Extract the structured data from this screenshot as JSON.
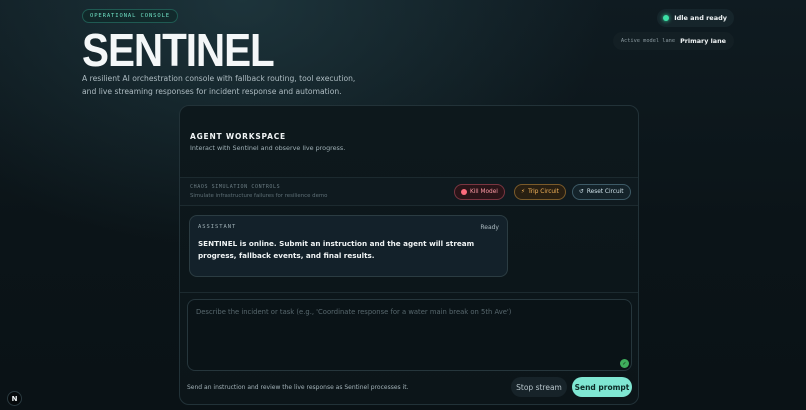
{
  "header": {
    "badge": "OPERATIONAL CONSOLE",
    "title": "SENTINEL",
    "subtitle": "A resilient AI orchestration console with fallback routing, tool execution, and live streaming responses for incident response and automation."
  },
  "status": {
    "text": "Idle and ready",
    "lane_label": "Active model lane",
    "lane_value": "Primary lane",
    "accent": "#3ce0a6"
  },
  "workspace": {
    "title": "AGENT WORKSPACE",
    "subtitle": "Interact with Sentinel and observe live progress."
  },
  "chaos": {
    "title": "CHAOS SIMULATION CONTROLS",
    "subtitle": "Simulate infrastructure failures for resilience demo",
    "kill": "Kill Model",
    "trip": "Trip Circuit",
    "reset": "Reset Circuit",
    "icons": [
      "stop-icon",
      "lightning-icon",
      "refresh-icon"
    ]
  },
  "assistant": {
    "label": "ASSISTANT",
    "state": "Ready",
    "message": "SENTINEL is online. Submit an instruction and the agent will stream progress, fallback events, and final results."
  },
  "composer": {
    "placeholder": "Describe the incident or task (e.g., 'Coordinate response for a water main break on 5th Ave')",
    "footnote": "Send an instruction and review the live response as Sentinel processes it.",
    "stop": "Stop stream",
    "send": "Send prompt",
    "accent": "#7fe6d2"
  },
  "corner": {
    "label": "N"
  }
}
